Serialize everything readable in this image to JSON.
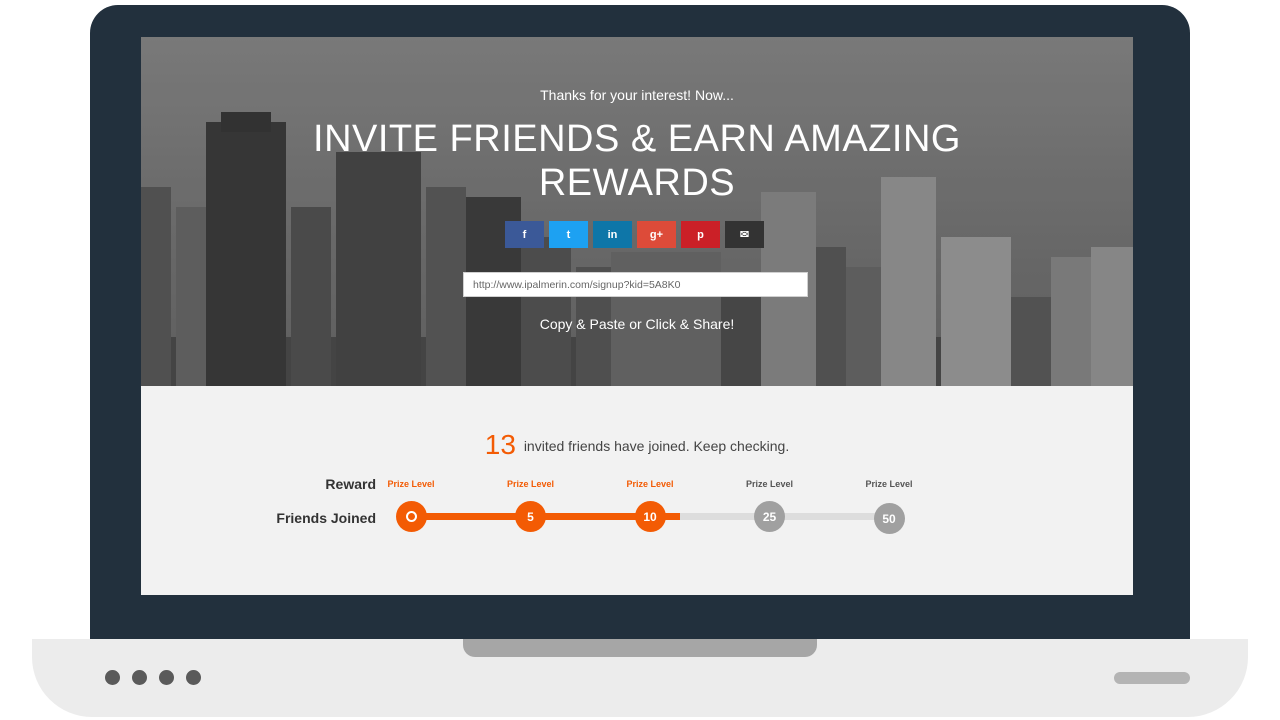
{
  "hero": {
    "thanks": "Thanks for your interest! Now...",
    "headline_line1": "INVITE FRIENDS & EARN AMAZING",
    "headline_line2": "REWARDS",
    "share_url": "http://www.ipalmerin.com/signup?kid=5A8K0",
    "copy_note": "Copy & Paste or Click & Share!"
  },
  "social": [
    {
      "name": "facebook",
      "glyph": "f",
      "color": "#3b5998"
    },
    {
      "name": "twitter",
      "glyph": "t",
      "color": "#1da1f2"
    },
    {
      "name": "linkedin",
      "glyph": "in",
      "color": "#0e76a8"
    },
    {
      "name": "google-plus",
      "glyph": "g+",
      "color": "#dd4b39"
    },
    {
      "name": "pinterest",
      "glyph": "p",
      "color": "#cb2027"
    },
    {
      "name": "email",
      "glyph": "✉",
      "color": "#333333"
    }
  ],
  "progress": {
    "count": "13",
    "message": "invited friends have joined. Keep checking.",
    "reward_label": "Reward",
    "friends_label": "Friends Joined",
    "prize_text": "Prize Level",
    "levels": [
      "0",
      "5",
      "10",
      "25",
      "50"
    ],
    "reached": [
      true,
      true,
      true,
      false,
      false
    ],
    "fill_to_index": 2.25,
    "accent": "#f35b04",
    "inactive": "#a0a0a0"
  }
}
